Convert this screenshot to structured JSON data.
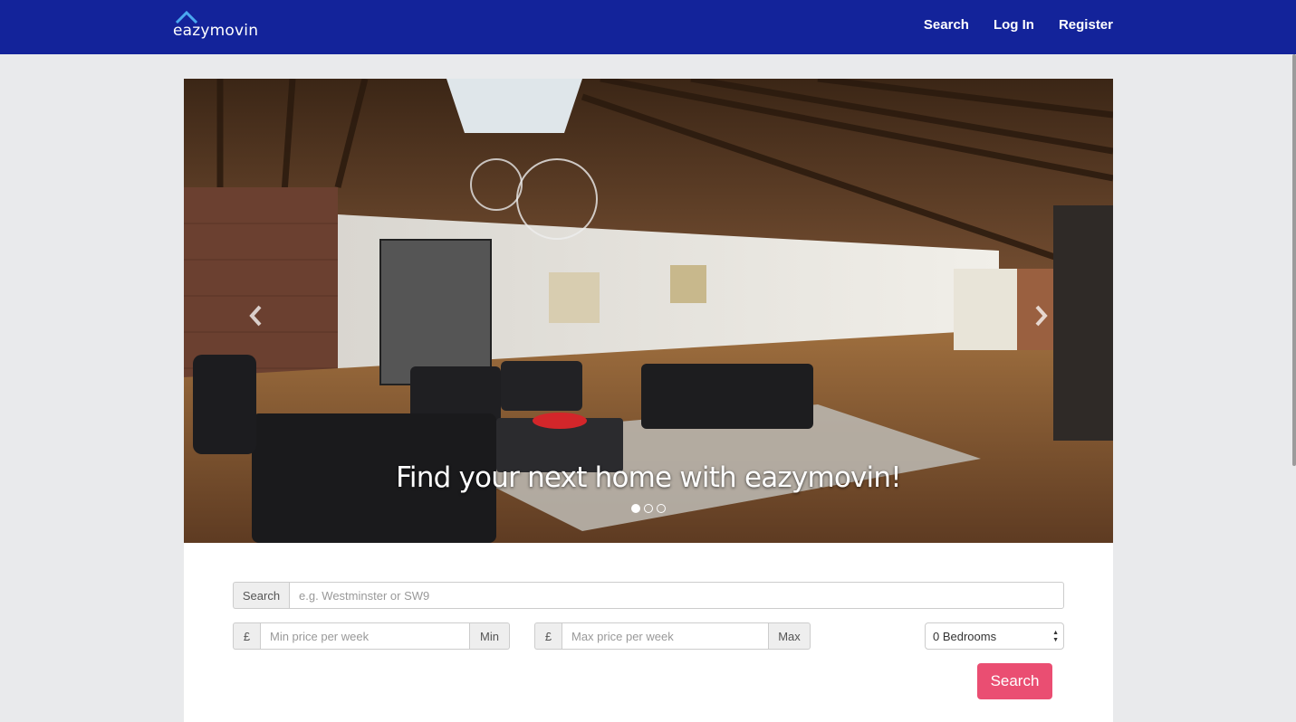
{
  "brand": {
    "name": "eazymovin",
    "accent": "#4aa8f0"
  },
  "colors": {
    "navbar": "#13239a",
    "page_bg": "#e9eaec",
    "button": "#ea4e72"
  },
  "nav": {
    "links": [
      "Search",
      "Log In",
      "Register"
    ]
  },
  "carousel": {
    "caption": "Find your next home with eazymovin!",
    "slide_count": 3,
    "active_slide": 1,
    "prev_icon": "chevron-left-icon",
    "next_icon": "chevron-right-icon"
  },
  "search_form": {
    "location": {
      "addon": "Search",
      "placeholder": "e.g. Westminster or SW9"
    },
    "min_price": {
      "currency": "£",
      "placeholder": "Min price per week",
      "suffix": "Min"
    },
    "max_price": {
      "currency": "£",
      "placeholder": "Max price per week",
      "suffix": "Max"
    },
    "bedrooms": {
      "selected": "0 Bedrooms"
    },
    "submit_label": "Search"
  }
}
